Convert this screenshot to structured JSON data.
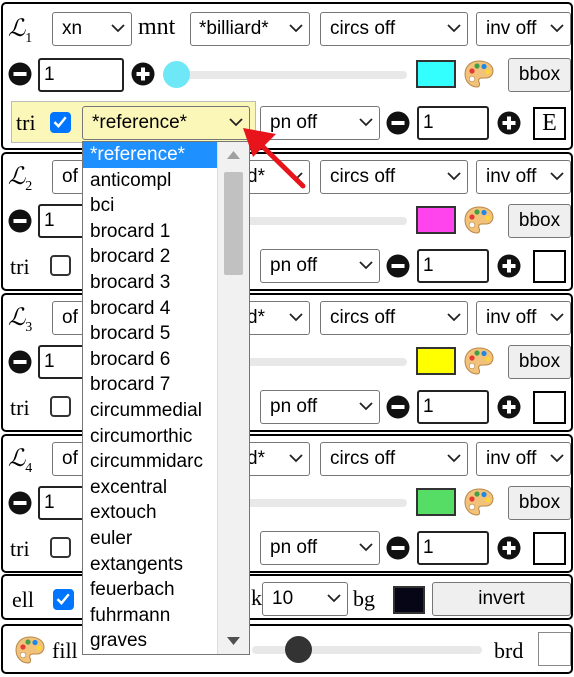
{
  "colors": {
    "accent": "#0075ff",
    "tri_highlight": "#fbf7b9",
    "arrow": "#e8141c",
    "cyan": "#33ffff",
    "magenta": "#ff44ee",
    "yellow": "#ffff00",
    "green": "#55dd66",
    "bg_swatch": "#060616",
    "dd_highlight": "#1e90ff"
  },
  "panels": [
    {
      "label_script": "ℒ",
      "label_sub": "1",
      "sel1": "xn",
      "word": "mnt",
      "sel2": "*billiard*",
      "circs": "circs off",
      "inv": "inv off",
      "step_value": "1",
      "swatch_color": "#33ffff",
      "bbox": "bbox",
      "tri": "tri",
      "tri_checked": true,
      "tri_sel": "*reference*",
      "pn": "pn off",
      "tri_value": "1",
      "ebox": "E"
    },
    {
      "label_script": "ℒ",
      "label_sub": "2",
      "sel1_partial": "of",
      "sel2_partial": "d*",
      "circs": "circs off",
      "inv": "inv off",
      "step_value": "1",
      "swatch_color": "#ff44ee",
      "bbox": "bbox",
      "tri": "tri",
      "tri_checked": false,
      "pn": "pn off",
      "tri_value": "1",
      "ebox": ""
    },
    {
      "label_script": "ℒ",
      "label_sub": "3",
      "sel1_partial": "of",
      "sel2_partial": "d*",
      "circs": "circs off",
      "inv": "inv off",
      "step_value": "1",
      "swatch_color": "#ffff00",
      "bbox": "bbox",
      "tri": "tri",
      "tri_checked": false,
      "pn": "pn off",
      "tri_value": "1",
      "ebox": ""
    },
    {
      "label_script": "ℒ",
      "label_sub": "4",
      "sel1_partial": "of",
      "sel2_partial": "d*",
      "circs": "circs off",
      "inv": "inv off",
      "step_value": "1",
      "swatch_color": "#55dd66",
      "bbox": "bbox",
      "tri": "tri",
      "tri_checked": false,
      "pn": "pn off",
      "tri_value": "1",
      "ebox": ""
    }
  ],
  "ell_row": {
    "label": "ell",
    "checked": true,
    "partial": "k",
    "sel": "10",
    "bg_label": "bg",
    "bg_color": "#060616",
    "invert": "invert"
  },
  "fill_row": {
    "label": "fill",
    "brd": "brd"
  },
  "dropdown": {
    "selected": "*reference*",
    "options": [
      "*reference*",
      "anticompl",
      "bci",
      "brocard 1",
      "brocard 2",
      "brocard 3",
      "brocard 4",
      "brocard 5",
      "brocard 6",
      "brocard 7",
      "circummedial",
      "circumorthic",
      "circummidarc",
      "excentral",
      "extouch",
      "euler",
      "extangents",
      "feuerbach",
      "fuhrmann",
      "graves"
    ]
  }
}
